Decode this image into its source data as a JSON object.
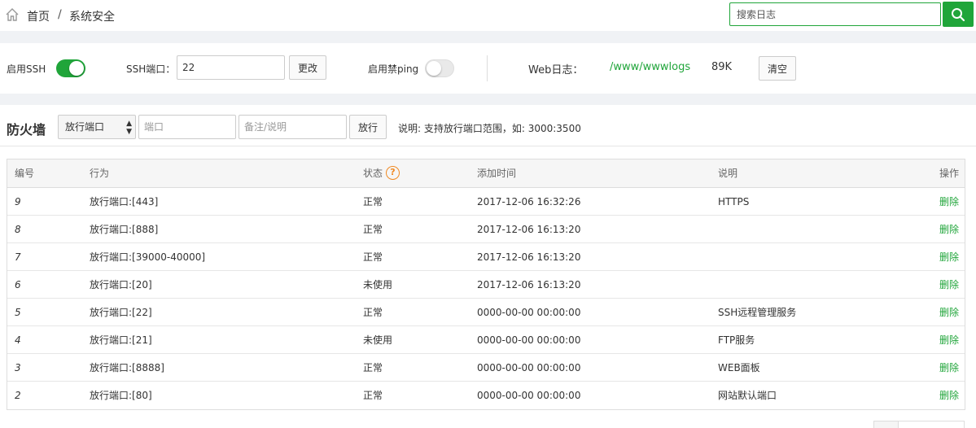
{
  "breadcrumb": {
    "home": "首页",
    "separator": "/",
    "current": "系统安全"
  },
  "search": {
    "placeholder": "搜索日志"
  },
  "ssh": {
    "enable_label": "启用SSH",
    "enabled": true,
    "port_label": "SSH端口：",
    "port_value": "22",
    "change_button": "更改",
    "ping_label": "启用禁ping",
    "ping_enabled": false,
    "weblog_label": "Web日志：",
    "weblog_path": "/www/wwwlogs",
    "weblog_size": "89K",
    "clear_button": "清空"
  },
  "firewall": {
    "title": "防火墙",
    "select_value": "放行端口",
    "port_placeholder": "端口",
    "note_placeholder": "备注/说明",
    "allow_button": "放行",
    "hint": "说明: 支持放行端口范围，如: 3000:3500"
  },
  "table": {
    "headers": {
      "id": "编号",
      "action": "行为",
      "status": "状态",
      "time": "添加时间",
      "desc": "说明",
      "op": "操作"
    },
    "rows": [
      {
        "id": "9",
        "action": "放行端口:[443]",
        "status": "正常",
        "time": "2017-12-06 16:32:26",
        "desc": "HTTPS",
        "op": "删除"
      },
      {
        "id": "8",
        "action": "放行端口:[888]",
        "status": "正常",
        "time": "2017-12-06 16:13:20",
        "desc": "",
        "op": "删除"
      },
      {
        "id": "7",
        "action": "放行端口:[39000-40000]",
        "status": "正常",
        "time": "2017-12-06 16:13:20",
        "desc": "",
        "op": "删除"
      },
      {
        "id": "6",
        "action": "放行端口:[20]",
        "status": "未使用",
        "time": "2017-12-06 16:13:20",
        "desc": "",
        "op": "删除"
      },
      {
        "id": "5",
        "action": "放行端口:[22]",
        "status": "正常",
        "time": "0000-00-00 00:00:00",
        "desc": "SSH远程管理服务",
        "op": "删除"
      },
      {
        "id": "4",
        "action": "放行端口:[21]",
        "status": "未使用",
        "time": "0000-00-00 00:00:00",
        "desc": "FTP服务",
        "op": "删除"
      },
      {
        "id": "3",
        "action": "放行端口:[8888]",
        "status": "正常",
        "time": "0000-00-00 00:00:00",
        "desc": "WEB面板",
        "op": "删除"
      },
      {
        "id": "2",
        "action": "放行端口:[80]",
        "status": "正常",
        "time": "0000-00-00 00:00:00",
        "desc": "网站默认端口",
        "op": "删除"
      }
    ]
  },
  "colors": {
    "accent": "#20a53a",
    "help": "#f08a24"
  }
}
